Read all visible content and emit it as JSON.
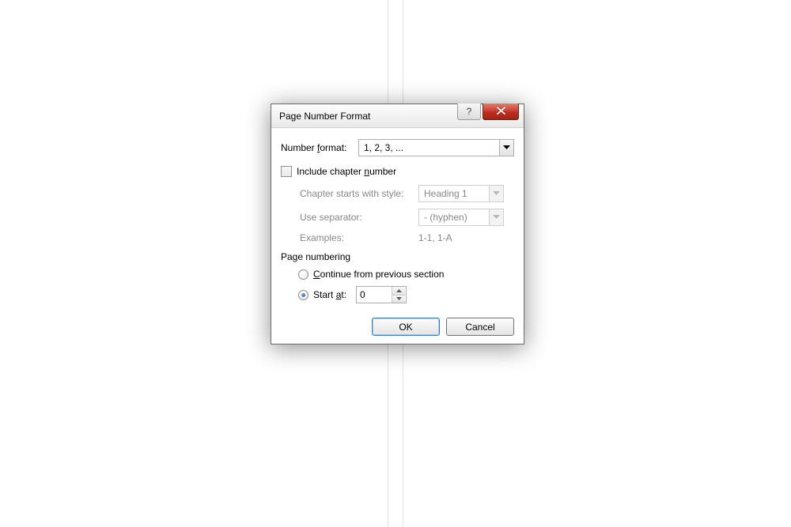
{
  "dialog": {
    "title": "Page Number Format",
    "help_glyph": "?",
    "number_format_label": "Number format:",
    "number_format_value": "1, 2, 3, ...",
    "include_chapter_label_pre": "Include chapter ",
    "include_chapter_label_u": "n",
    "include_chapter_label_post": "umber",
    "include_chapter_checked": false,
    "chapter": {
      "starts_with_label": "Chapter starts with style:",
      "starts_with_value": "Heading 1",
      "separator_label": "Use separator:",
      "separator_value": "-   (hyphen)",
      "examples_label": "Examples:",
      "examples_value": "1-1, 1-A"
    },
    "page_numbering_label": "Page numbering",
    "continue_label_u": "C",
    "continue_label_post": "ontinue from previous section",
    "start_at_label_pre": "Start ",
    "start_at_label_u": "a",
    "start_at_label_post": "t:",
    "start_at_value": "0",
    "start_at_selected": true,
    "ok_label": "OK",
    "cancel_label": "Cancel"
  }
}
